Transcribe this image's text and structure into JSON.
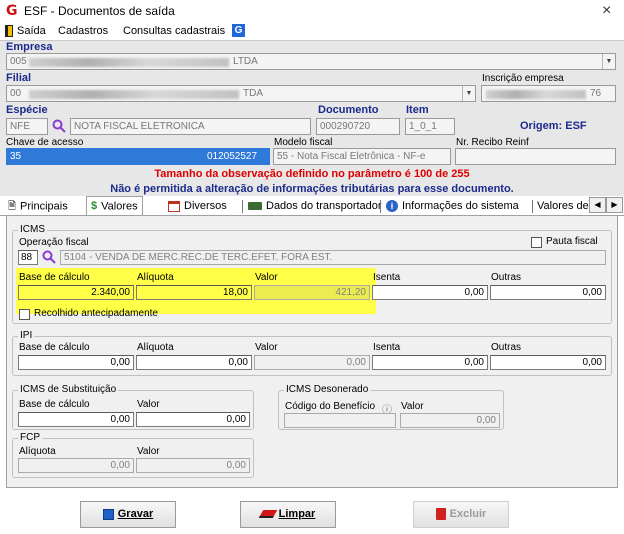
{
  "window": {
    "title": "ESF - Documentos de saída",
    "close": "×"
  },
  "menu": [
    {
      "label": "Saída"
    },
    {
      "label": "Cadastros"
    },
    {
      "label": "Consultas cadastrais"
    }
  ],
  "header": {
    "empresa": {
      "label": "Empresa",
      "code": "005",
      "suffix": "LTDA"
    },
    "filial": {
      "label": "Filial",
      "code": "00",
      "suffix": "TDA"
    },
    "inscricao": {
      "label": "Inscrição empresa",
      "suffix": "76"
    },
    "especie": {
      "label": "Espécie",
      "code": "NFE",
      "description": "NOTA FISCAL ELETRONICA"
    },
    "documento": {
      "label": "Documento",
      "value": "000290720"
    },
    "item": {
      "label": "Item",
      "value": "1_0_1"
    },
    "origem": "Origem: ESF",
    "chave": {
      "label": "Chave de acesso",
      "prefix": "35",
      "suffix": "012052527"
    },
    "modelo": {
      "label": "Modelo fiscal",
      "value": "55 - Nota Fiscal Eletrônica - NF-e"
    },
    "recibo": {
      "label": "Nr. Recibo Reinf",
      "value": ""
    }
  },
  "warnings": {
    "line1": "Tamanho da observação definido no parâmetro é 100 de 255",
    "line2": "Não é permitida a alteração de informações tributárias para esse documento.",
    "color1": "#e00000",
    "color2": "#1b2a8c"
  },
  "tabs": [
    {
      "label": "Principais"
    },
    {
      "label": "Valores"
    },
    {
      "label": "Diversos"
    },
    {
      "label": "Dados do transportador"
    },
    {
      "label": "Informações do sistema"
    },
    {
      "label": "Valores de ir"
    }
  ],
  "icms": {
    "title": "ICMS",
    "operacao_label": "Operação fiscal",
    "operacao_code": "88",
    "operacao_desc": "5104 - VENDA DE MERC.REC.DE TERC.EFET. FORA EST.",
    "pauta_label": "Pauta fiscal",
    "base_label": "Base de cálculo",
    "base_value": "2.340,00",
    "aliquota_label": "Alíquota",
    "aliquota_value": "18,00",
    "valor_label": "Valor",
    "valor_value": "421,20",
    "isenta_label": "Isenta",
    "isenta_value": "0,00",
    "outras_label": "Outras",
    "outras_value": "0,00",
    "recolhido_label": "Recolhido antecipadamente"
  },
  "ipi": {
    "title": "IPI",
    "base_label": "Base de cálculo",
    "base_value": "0,00",
    "aliquota_label": "Alíquota",
    "aliquota_value": "0,00",
    "valor_label": "Valor",
    "valor_value": "0,00",
    "isenta_label": "Isenta",
    "isenta_value": "0,00",
    "outras_label": "Outras",
    "outras_value": "0,00"
  },
  "icms_st": {
    "title": "ICMS de Substituição",
    "base_label": "Base de cálculo",
    "base_value": "0,00",
    "valor_label": "Valor",
    "valor_value": "0,00"
  },
  "icms_deson": {
    "title": "ICMS Desonerado",
    "codigo_label": "Código do Benefício",
    "valor_label": "Valor",
    "valor_value": "0,00"
  },
  "fcp": {
    "title": "FCP",
    "aliquota_label": "Alíquota",
    "aliquota_value": "0,00",
    "valor_label": "Valor",
    "valor_value": "0,00"
  },
  "buttons": {
    "gravar": "Gravar",
    "limpar": "Limpar",
    "excluir": "Excluir"
  }
}
